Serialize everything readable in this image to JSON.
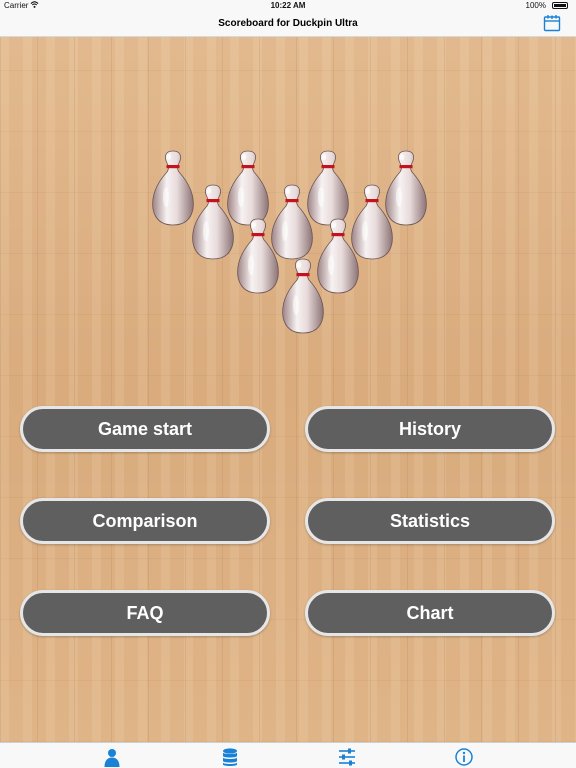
{
  "status_bar": {
    "carrier": "Carrier",
    "time": "10:22 AM",
    "battery": "100%"
  },
  "nav": {
    "title": "Scoreboard for Duckpin Ultra",
    "right_icon": "calendar-icon"
  },
  "colors": {
    "accent": "#1a82d6",
    "button_fill": "#5f5f5f",
    "button_border": "#e6e6e6",
    "pin_stripe": "#c4131c",
    "wood": "#dcb084"
  },
  "menu": {
    "game_start": "Game start",
    "history": "History",
    "comparison": "Comparison",
    "statistics": "Statistics",
    "faq": "FAQ",
    "chart": "Chart"
  },
  "tabs": [
    {
      "icon": "person-icon",
      "selected": true
    },
    {
      "icon": "database-icon",
      "selected": false
    },
    {
      "icon": "sliders-icon",
      "selected": false
    },
    {
      "icon": "info-icon",
      "selected": false
    }
  ]
}
